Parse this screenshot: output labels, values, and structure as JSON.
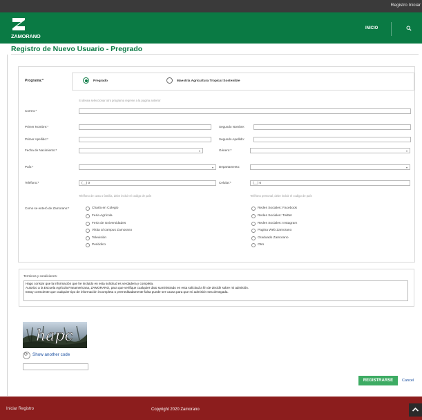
{
  "topbar": {
    "register_link": "Registro Iniciar"
  },
  "header": {
    "brand": "ZAMORANO",
    "nav_inicio": "INICIO",
    "search_icon": "search-icon",
    "colors": {
      "green": "#0a7a44",
      "footer": "#8c1d1d"
    }
  },
  "page": {
    "title": "Registro de Nuevo Usuario - Pregrado"
  },
  "form": {
    "programa_label": "Programa:*",
    "programa_options": [
      "Pregrado",
      "Maestría Agricultura Tropical Sostenible"
    ],
    "programa_selected": "Pregrado",
    "programa_hint": "Si desea seleccionar otro programa regrese a la pagina anterior",
    "correo_label": "Correo:*",
    "primer_nombre_label": "Primer Nombre:*",
    "segundo_nombre_label": "Segundo Nombre:",
    "primer_apellido_label": "Primer Apellido:*",
    "segundo_apellido_label": "Segundo Apellido:",
    "fecha_label": "Fecha de Nacimiento:*",
    "genero_label": "Género:*",
    "pais_label": "País:*",
    "departamento_label": "Departamento:",
    "telefono_label": "Teléfono:*",
    "telefono_value": "(__) 0",
    "telefono_hint": "Teléfono de casa o familia, debe incluir el codigo de país",
    "celular_label": "Celular:*",
    "celular_value": "(__) 0",
    "celular_hint": "Teléfono personal, debe incluir el codigo de país",
    "como_label": "Como se enteró de Zamorano:*",
    "como_options_left": [
      "Charla en Colegio",
      "Feria Agrícola",
      "Feria de Universidades",
      "Visita al campus Zamorano",
      "Televisión",
      "Periódico"
    ],
    "como_options_right": [
      "Redes Sociales: Facebook",
      "Redes Sociales: Twitter",
      "Redes Sociales: Instagram",
      "Pagina Web Zamorano",
      "Graduado Zamorano",
      "Otro"
    ]
  },
  "terms": {
    "label": "Terminos y condiciones:",
    "lines": [
      "Hago constar que la información que he incluido en esta solicitud es verdadera y completa.",
      "Autorizo a la Escuela Agrícola Panamericana, ZAMORANO, para que verifique cualquier dato suministrado en esta solicitud a fin de decidir sobre mi admisión.",
      "Estoy consciente que cualquier tipo de información incompleta o premeditadamente falsa puede ser causa para que mi admisión sea denegada."
    ]
  },
  "captcha": {
    "image_text": "hapc",
    "refresh_icon": "refresh-icon",
    "show_another": "Show another code"
  },
  "actions": {
    "register": "REGISTRARSE",
    "cancel": "Cancel"
  },
  "footer": {
    "links": "Iniciar  Registro",
    "copyright": "Copyright 2020 Zamorano",
    "top_icon": "chevron-up-icon"
  }
}
